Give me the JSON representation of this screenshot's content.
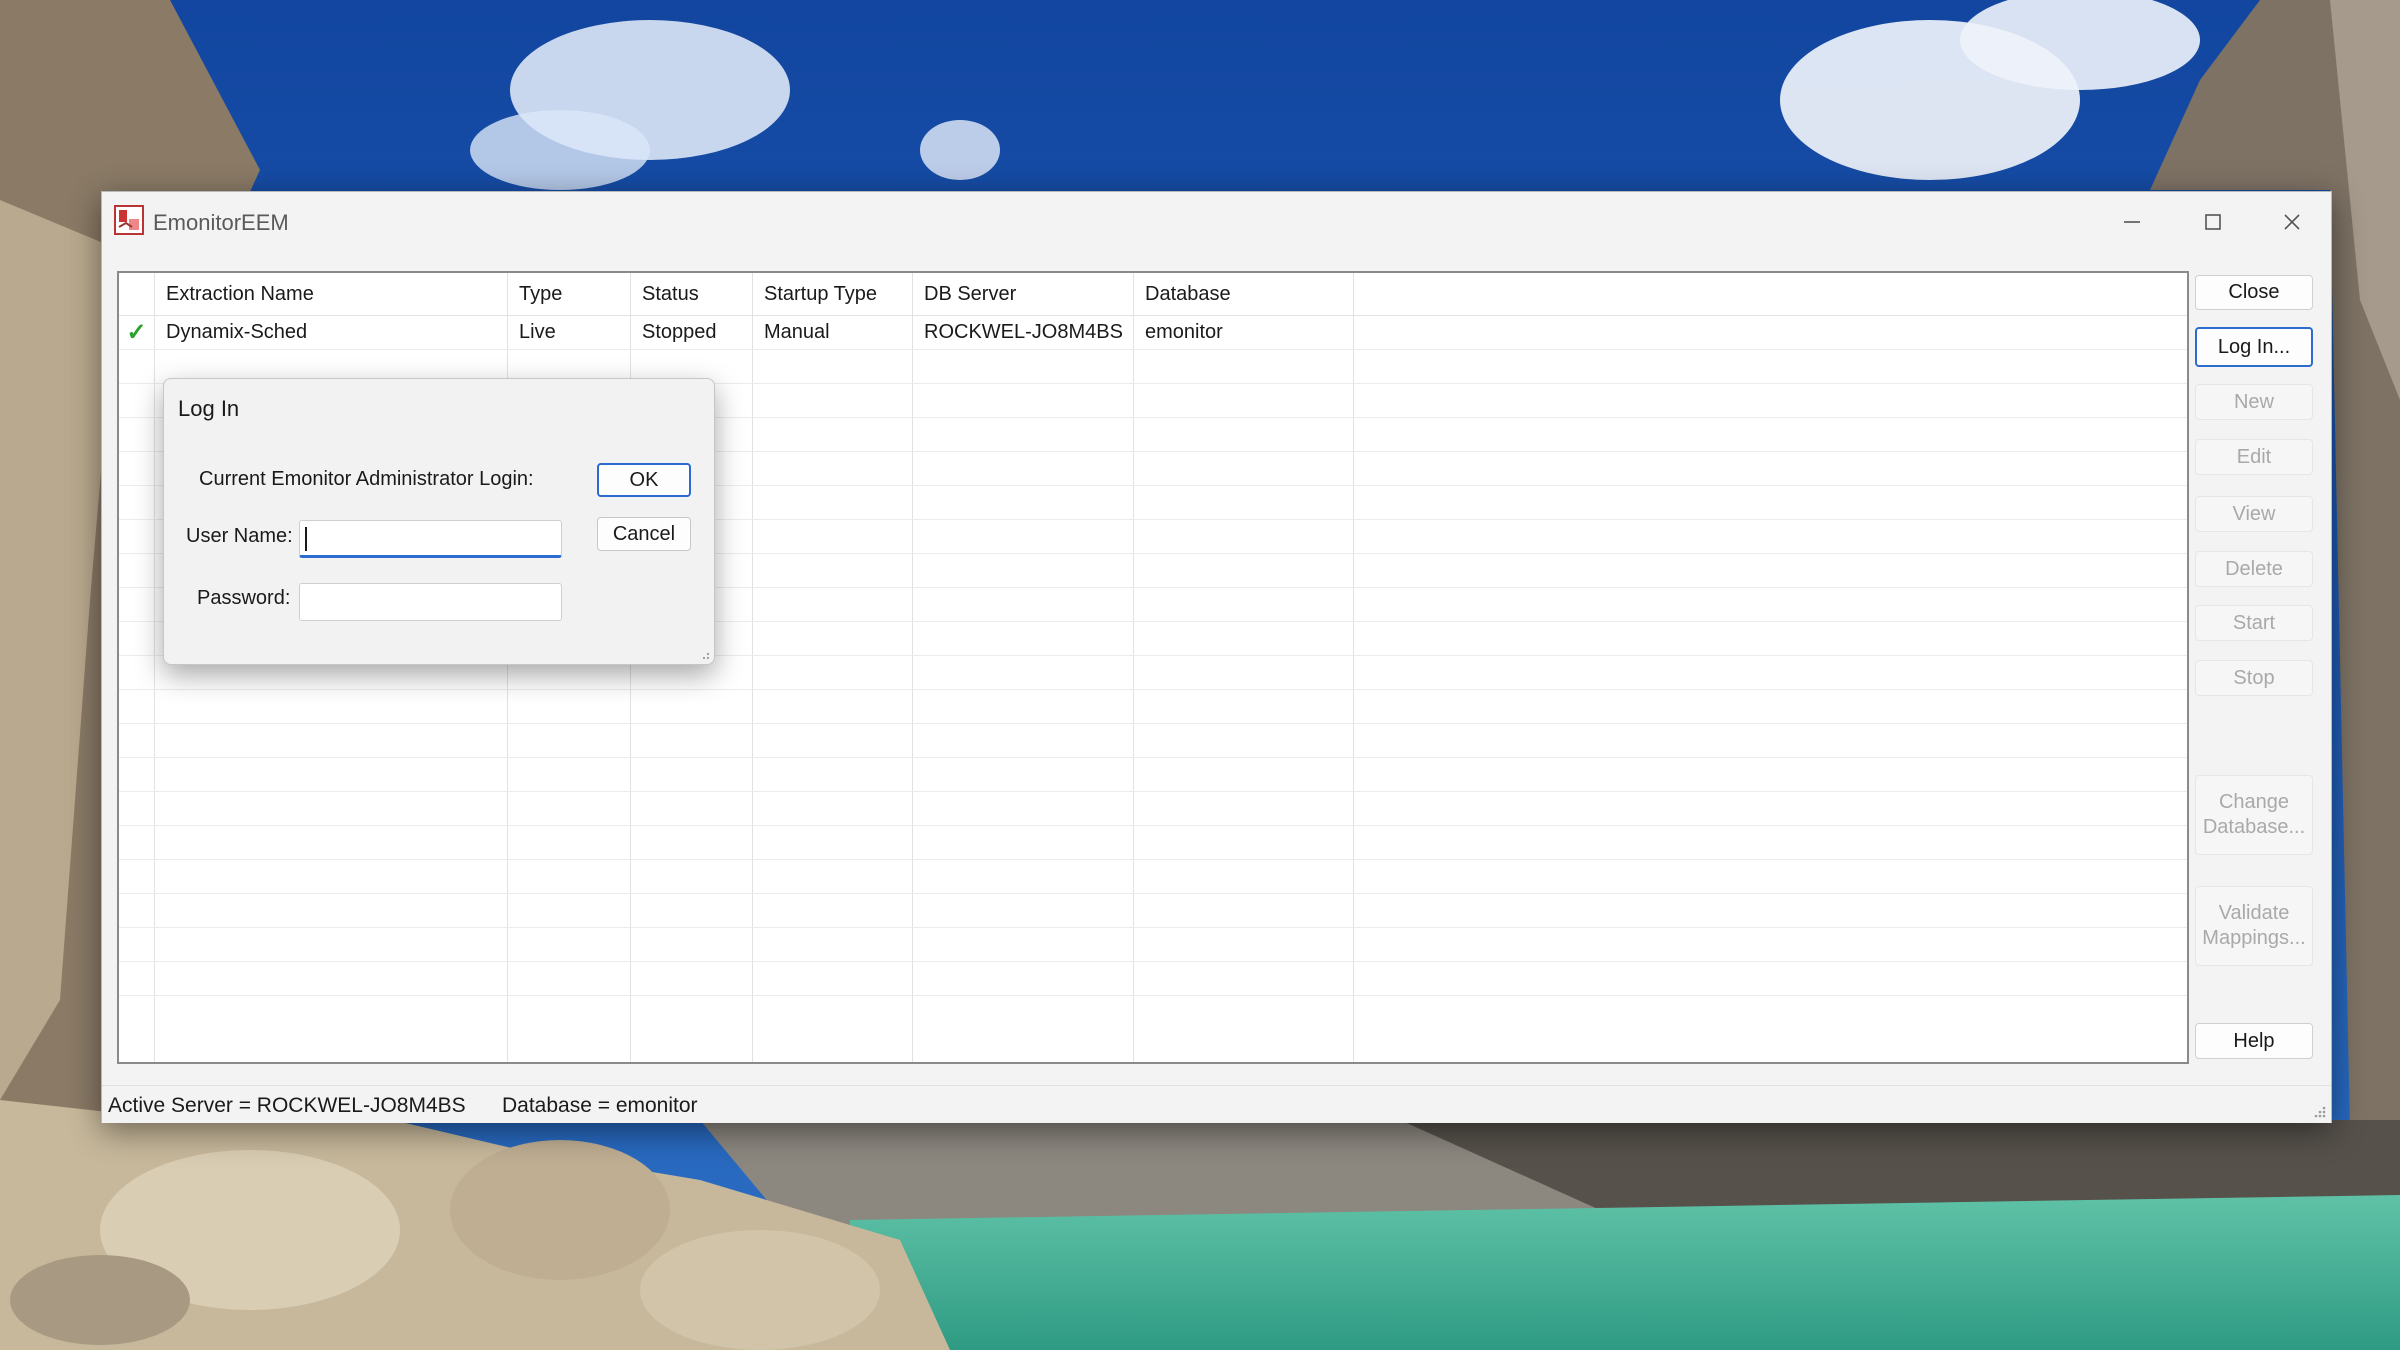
{
  "window": {
    "title": "EmonitorEEM"
  },
  "grid": {
    "columns": [
      "Extraction Name",
      "Type",
      "Status",
      "Startup Type",
      "DB Server",
      "Database"
    ],
    "rows": [
      {
        "checked": "✓",
        "extraction_name": "Dynamix-Sched",
        "type": "Live",
        "status": "Stopped",
        "startup_type": "Manual",
        "db_server": "ROCKWEL-JO8M4BS",
        "database": "emonitor"
      }
    ]
  },
  "side_buttons": {
    "close": "Close",
    "login": "Log In...",
    "new": "New",
    "edit": "Edit",
    "view": "View",
    "delete": "Delete",
    "start": "Start",
    "stop": "Stop",
    "change_database_line1": "Change",
    "change_database_line2": "Database...",
    "validate_mappings_line1": "Validate",
    "validate_mappings_line2": "Mappings...",
    "help": "Help"
  },
  "statusbar": {
    "active_server": "Active Server = ROCKWEL-JO8M4BS",
    "database": "Database = emonitor"
  },
  "login_dialog": {
    "title": "Log In",
    "current_login_label": "Current Emonitor Administrator Login:",
    "username_label": "User Name:",
    "username_value": "",
    "password_label": "Password:",
    "password_value": "",
    "ok": "OK",
    "cancel": "Cancel"
  },
  "colors": {
    "accent": "#2c6ccf",
    "check": "#2aa32a",
    "disabled_text": "#a9a9a9"
  }
}
